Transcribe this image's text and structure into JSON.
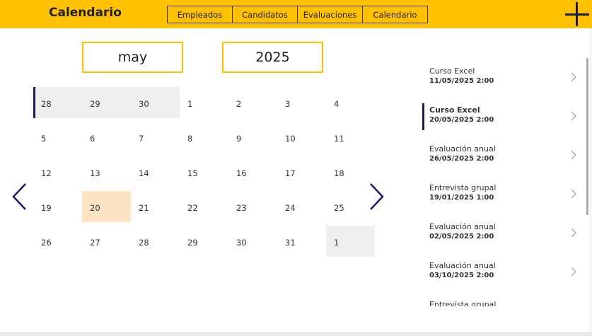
{
  "header": {
    "title": "Calendario",
    "nav": [
      "Empleados",
      "Candidatos",
      "Evaluaciones",
      "Calendario"
    ],
    "add_icon": "plus-icon",
    "color": "#FFC000"
  },
  "selectors": {
    "month": "may",
    "year": "2025"
  },
  "calendar": {
    "weeks": [
      [
        "28",
        "29",
        "30",
        "1",
        "2",
        "3",
        "4"
      ],
      [
        "5",
        "6",
        "7",
        "8",
        "9",
        "10",
        "11"
      ],
      [
        "12",
        "13",
        "14",
        "15",
        "16",
        "17",
        "18"
      ],
      [
        "19",
        "20",
        "21",
        "22",
        "23",
        "24",
        "25"
      ],
      [
        "26",
        "27",
        "28",
        "29",
        "30",
        "31",
        "1"
      ]
    ],
    "other_month_cells": [
      "0-0",
      "0-1",
      "0-2",
      "4-6"
    ],
    "selected_cell": "3-1",
    "colors": {
      "other": "#efefef",
      "selected": "#fde4c4",
      "accent": "#1a1a5a"
    },
    "prev_icon": "chevron-left-icon",
    "next_icon": "chevron-right-icon"
  },
  "events": [
    {
      "title": "Curso Excel",
      "date": "11/05/2025 2:00"
    },
    {
      "title": "Curso Excel",
      "date": "20/05/2025 2:00",
      "active": true
    },
    {
      "title": "Evaluación anual",
      "date": "26/05/2025 2:00"
    },
    {
      "title": "Entrevista grupal",
      "date": "19/01/2025 1:00"
    },
    {
      "title": "Evaluación anual",
      "date": "02/05/2025 2:00"
    },
    {
      "title": "Evaluación anual",
      "date": "03/10/2025 2:00"
    },
    {
      "title": "Entrevista grupal",
      "date": ""
    }
  ]
}
